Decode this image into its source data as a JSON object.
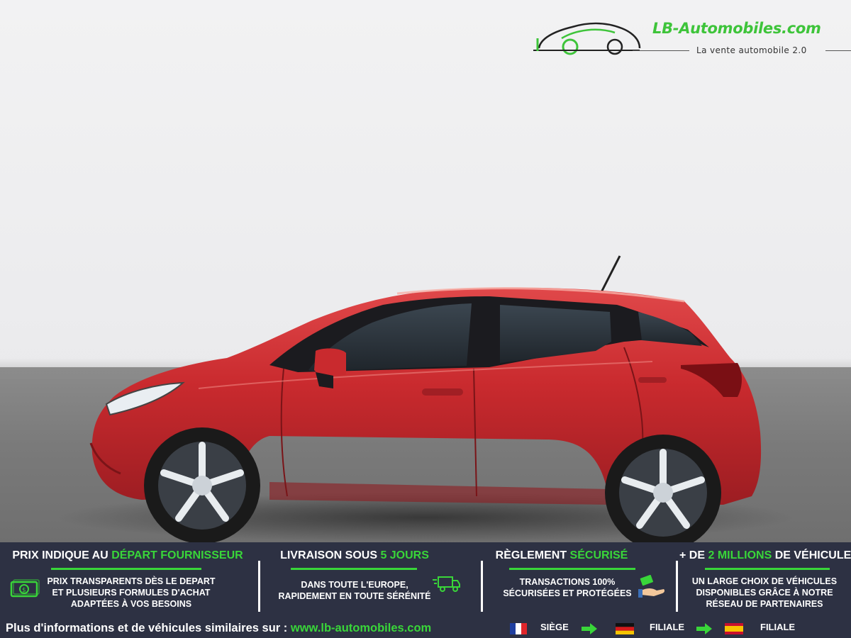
{
  "logo": {
    "name": "LB-Automobiles.com",
    "tagline": "La vente automobile 2.0"
  },
  "colors": {
    "brand_green": "#39d639",
    "banner_bg": "#2d3143",
    "car_red": "#c92a2e"
  },
  "features": [
    {
      "title_pre": "PRIX INDIQUE AU ",
      "title_hl": "DÉPART FOURNISSEUR",
      "title_post": "",
      "lines": [
        "PRIX TRANSPARENTS DÈS LE DEPART",
        "ET PLUSIEURS FORMULES D'ACHAT",
        "ADAPTÉES À VOS BESOINS"
      ],
      "icon": "money-icon"
    },
    {
      "title_pre": "LIVRAISON SOUS ",
      "title_hl": "5 JOURS",
      "title_post": "",
      "lines": [
        "DANS TOUTE L'EUROPE,",
        "RAPIDEMENT EN TOUTE SÉRÉNITÉ"
      ],
      "icon": "delivery-truck-icon"
    },
    {
      "title_pre": "RÈGLEMENT ",
      "title_hl": "SÉCURISÉ",
      "title_post": "",
      "lines": [
        "TRANSACTIONS 100%",
        "SÉCURISÉES ET PROTÉGÉES"
      ],
      "icon": "payment-hand-icon"
    },
    {
      "title_pre": "+ DE ",
      "title_hl": "2 MILLIONS",
      "title_post": " DE VÉHICULES",
      "lines": [
        "UN LARGE CHOIX DE VÉHICULES",
        "DISPONIBLES GRÂCE À NOTRE",
        "RÉSEAU DE PARTENAIRES"
      ],
      "icon": ""
    }
  ],
  "footer": {
    "text": "Plus d'informations et de véhicules similaires sur : ",
    "url": "www.lb-automobiles.com"
  },
  "locations": [
    {
      "flag": "france-flag-icon",
      "label": "SIÈGE"
    },
    {
      "flag": "germany-flag-icon",
      "label": "FILIALE"
    },
    {
      "flag": "spain-flag-icon",
      "label": "FILIALE"
    }
  ]
}
